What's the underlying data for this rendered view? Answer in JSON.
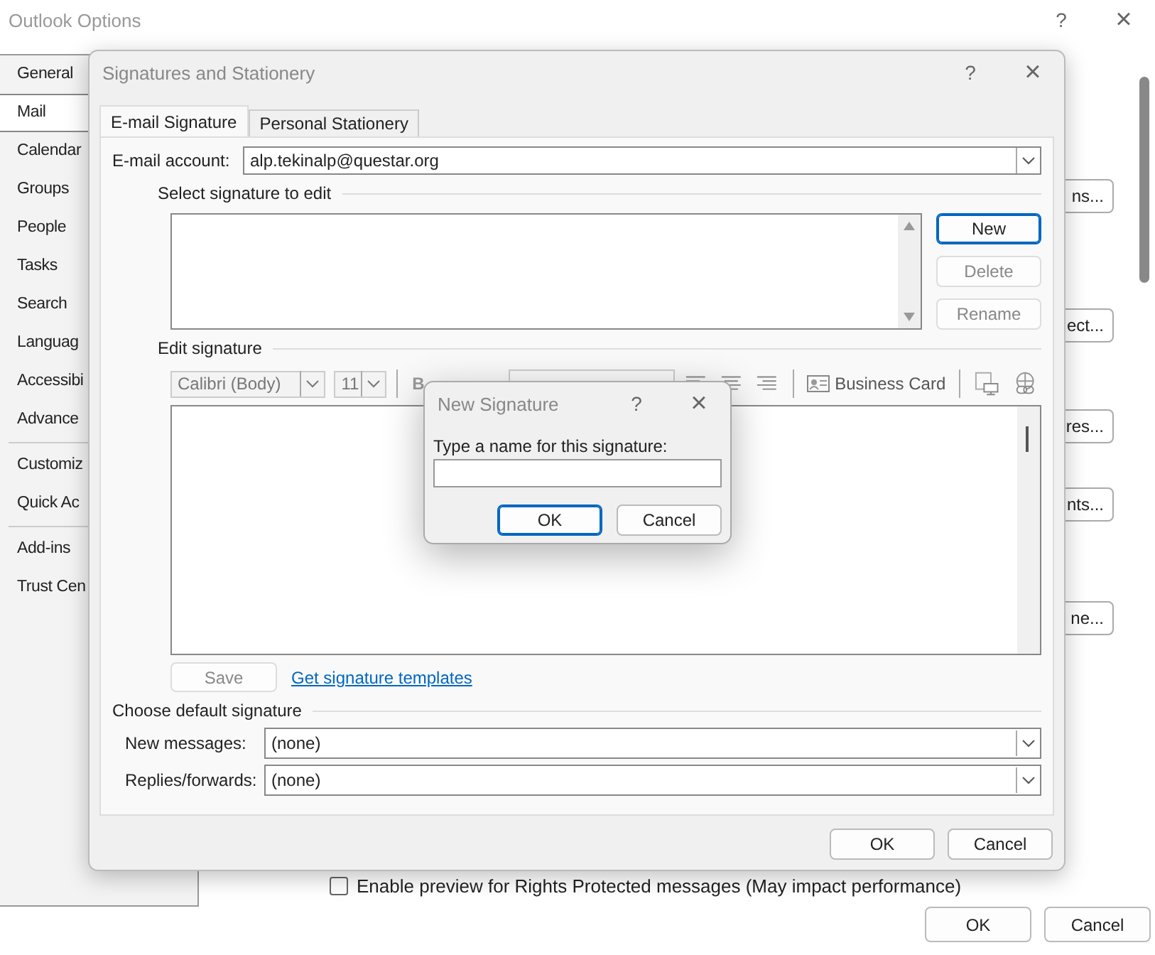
{
  "window": {
    "title": "Outlook Options",
    "help": "?",
    "close": "×"
  },
  "sidebar": {
    "items": [
      {
        "label": "General",
        "selected": false,
        "separator_after": false
      },
      {
        "label": "Mail",
        "selected": true,
        "separator_after": false
      },
      {
        "label": "Calendar",
        "selected": false,
        "separator_after": false
      },
      {
        "label": "Groups",
        "selected": false,
        "separator_after": false
      },
      {
        "label": "People",
        "selected": false,
        "separator_after": false
      },
      {
        "label": "Tasks",
        "selected": false,
        "separator_after": false
      },
      {
        "label": "Search",
        "selected": false,
        "separator_after": false
      },
      {
        "label": "Languag",
        "selected": false,
        "separator_after": false
      },
      {
        "label": "Accessibi",
        "selected": false,
        "separator_after": false
      },
      {
        "label": "Advance",
        "selected": false,
        "separator_after": true
      },
      {
        "label": "Customiz",
        "selected": false,
        "separator_after": false
      },
      {
        "label": "Quick Ac",
        "selected": false,
        "separator_after": true
      },
      {
        "label": "Add-ins",
        "selected": false,
        "separator_after": false
      },
      {
        "label": "Trust Cen",
        "selected": false,
        "separator_after": false
      }
    ]
  },
  "background_buttons": [
    "ns...",
    "ect...",
    "res...",
    "nts...",
    "ne..."
  ],
  "background_checkbox": {
    "label": "Enable preview for Rights Protected messages (May impact performance)",
    "checked": false
  },
  "footer_buttons": [
    {
      "label": "OK",
      "default": false
    },
    {
      "label": "Cancel",
      "default": false
    }
  ],
  "signatures_dialog": {
    "title": "Signatures and Stationery",
    "help": "?",
    "close": "×",
    "tabs": [
      {
        "label": "E-mail Signature",
        "selected": true
      },
      {
        "label": "Personal Stationery",
        "selected": false
      }
    ],
    "account": {
      "label": "E-mail account:",
      "value": "alp.tekinalp@questar.org"
    },
    "select_section": "Select signature to edit",
    "signature_buttons": [
      {
        "label": "New",
        "disabled": false,
        "default": true
      },
      {
        "label": "Delete",
        "disabled": true,
        "default": false
      },
      {
        "label": "Rename",
        "disabled": true,
        "default": false
      }
    ],
    "edit_section": "Edit signature",
    "toolbar": {
      "font": "Calibri (Body)",
      "size": "11",
      "bold": "B",
      "business_card": "Business Card"
    },
    "save": {
      "label": "Save",
      "disabled": true
    },
    "templates_link": "Get signature templates",
    "default_section": "Choose default signature",
    "defaults": [
      {
        "label": "New messages:",
        "value": "(none)"
      },
      {
        "label": "Replies/forwards:",
        "value": "(none)"
      }
    ],
    "buttons": [
      {
        "label": "OK",
        "default": false
      },
      {
        "label": "Cancel",
        "default": false
      }
    ]
  },
  "new_signature_dialog": {
    "title": "New Signature",
    "help": "?",
    "close": "×",
    "prompt": "Type a name for this signature:",
    "buttons": [
      {
        "label": "OK",
        "default": true
      },
      {
        "label": "Cancel",
        "default": false
      }
    ]
  }
}
